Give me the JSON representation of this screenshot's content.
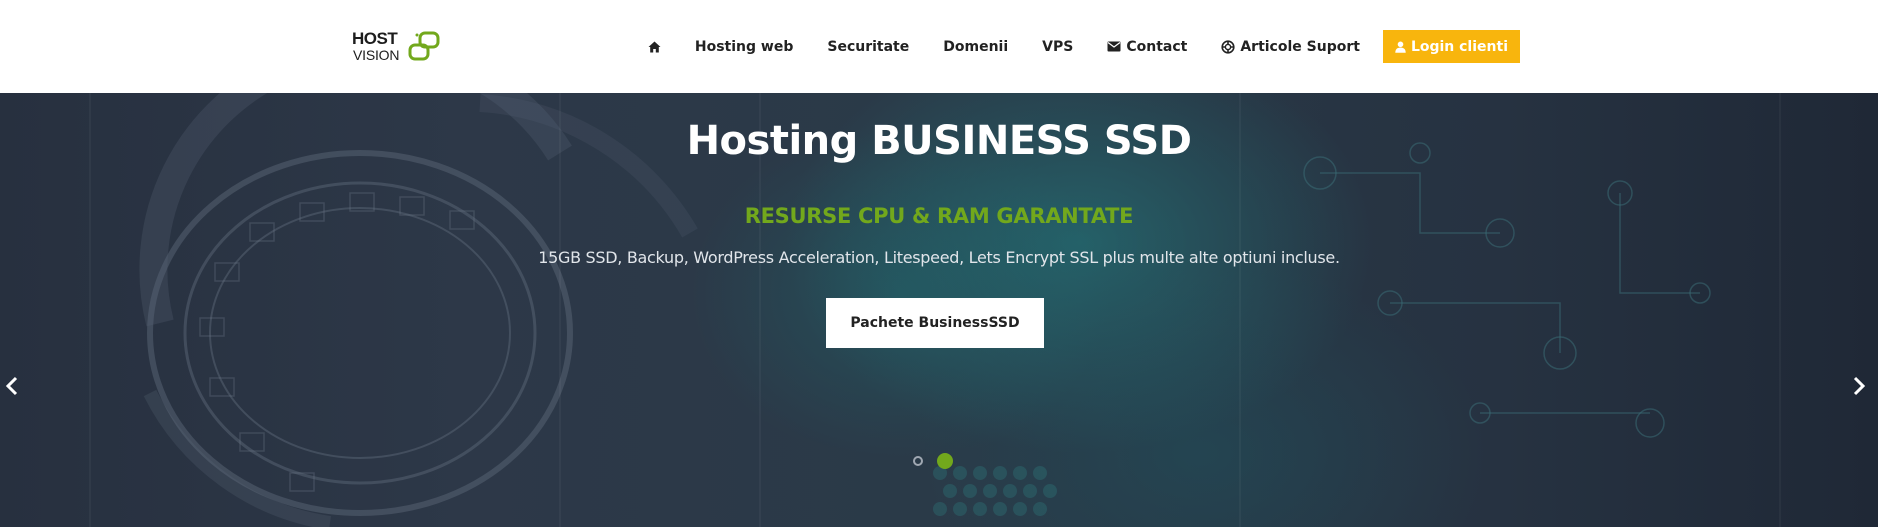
{
  "logo": {
    "line1": "HOST",
    "line2": "VISION",
    "mark_color": "#72a81c"
  },
  "nav": {
    "home_icon": "home-icon",
    "items": [
      {
        "label": "Hosting web"
      },
      {
        "label": "Securitate"
      },
      {
        "label": "Domenii"
      },
      {
        "label": "VPS"
      },
      {
        "label": "Contact",
        "icon": "envelope-icon"
      },
      {
        "label": "Articole Suport",
        "icon": "lifebuoy-icon"
      }
    ],
    "login": {
      "label": "Login clienti",
      "icon": "user-icon",
      "color": "#f8b50d"
    }
  },
  "hero": {
    "title": "Hosting BUSINESS SSD",
    "subtitle": "RESURSE CPU & RAM GARANTATE",
    "subtitle_color": "#72a81c",
    "description": "15GB SSD, Backup, WordPress Acceleration, Litespeed, Lets Encrypt SSL plus multe alte optiuni incluse.",
    "button_label": "Pachete BusinessSSD",
    "prev_icon": "chevron-left-icon",
    "next_icon": "chevron-right-icon",
    "slides": {
      "count": 2,
      "active": 2
    }
  }
}
